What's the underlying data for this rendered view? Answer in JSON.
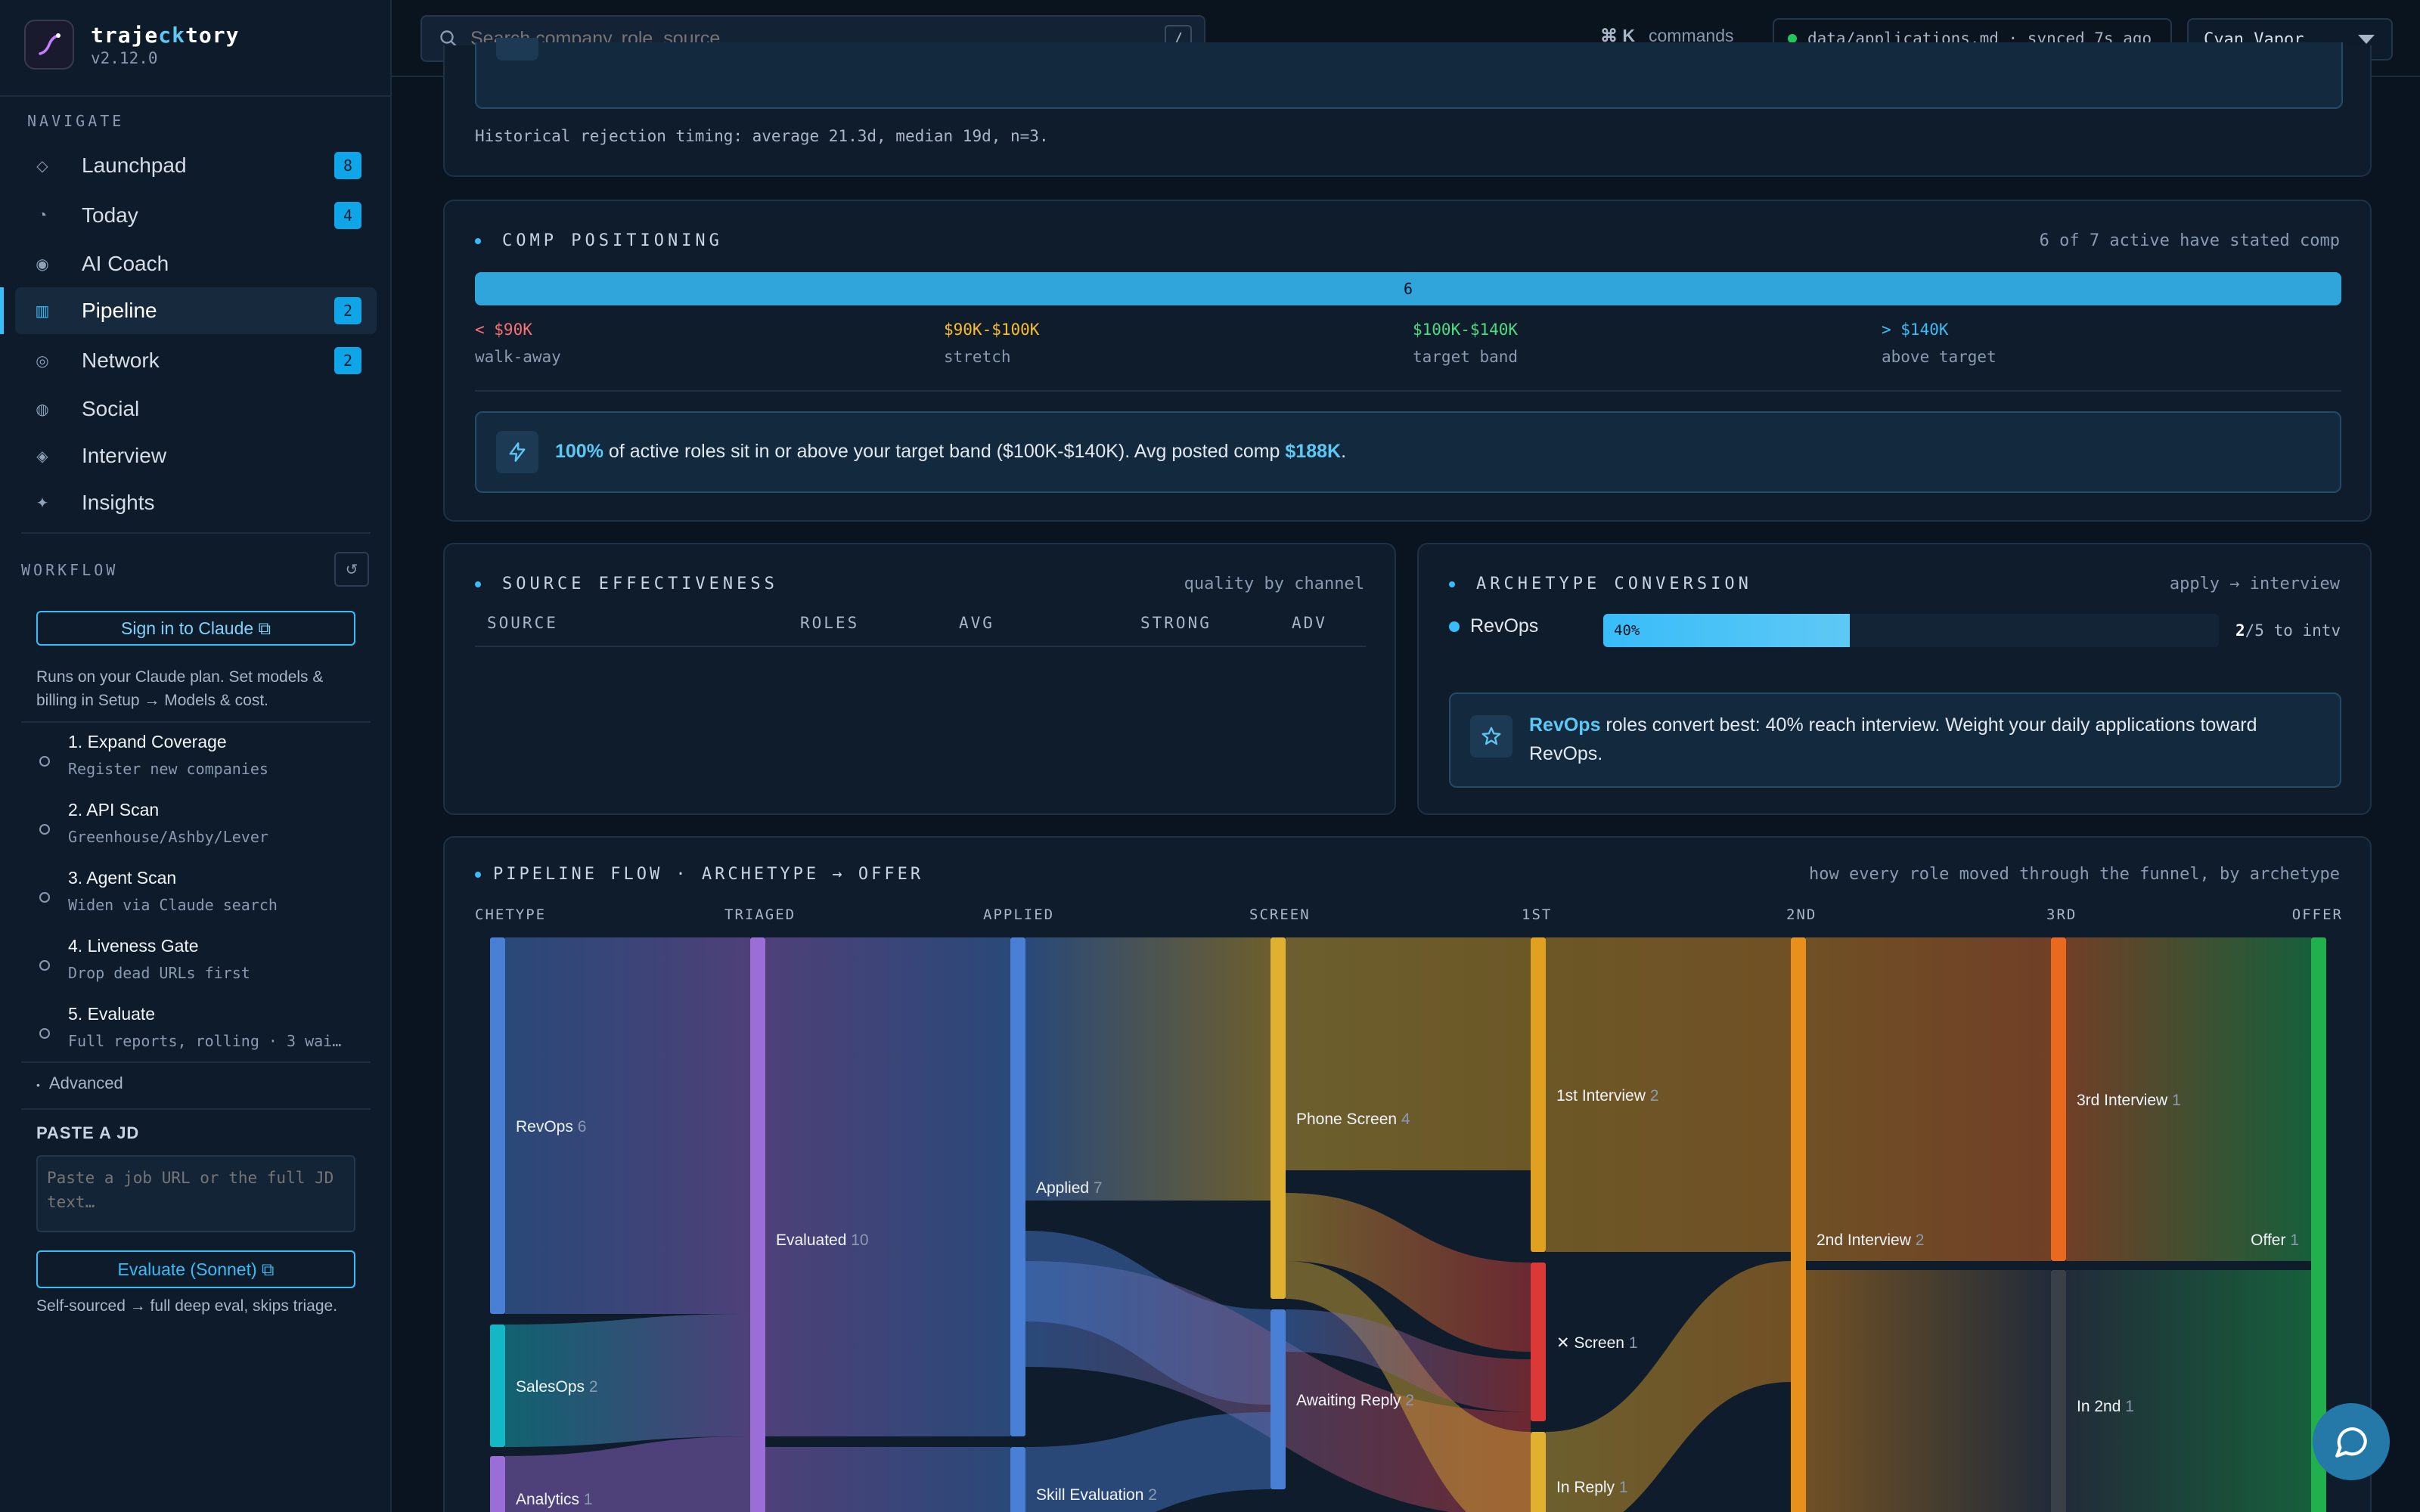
{
  "brand": {
    "name_prefix": "traje",
    "name_hl": "ck",
    "name_suffix": "tory",
    "version": "v2.12.0"
  },
  "sidebar": {
    "navigate_label": "NAVIGATE",
    "items": [
      {
        "label": "Launchpad",
        "icon": "diamond-icon",
        "badge": "8"
      },
      {
        "label": "Today",
        "icon": "clock-icon",
        "badge": "4"
      },
      {
        "label": "AI Coach",
        "icon": "target-icon",
        "badge": ""
      },
      {
        "label": "Pipeline",
        "icon": "columns-icon",
        "badge": "2",
        "active": true
      },
      {
        "label": "Network",
        "icon": "network-icon",
        "badge": "2"
      },
      {
        "label": "Social",
        "icon": "social-icon",
        "badge": ""
      },
      {
        "label": "Interview",
        "icon": "interview-icon",
        "badge": ""
      },
      {
        "label": "Insights",
        "icon": "sparkle-icon",
        "badge": ""
      }
    ],
    "workflow_label": "WORKFLOW",
    "sign_in_label": "Sign in to Claude ⧉",
    "plan_text": "Runs on your Claude plan. Set models & billing in Setup → Models & cost.",
    "steps": [
      {
        "title": "1. Expand Coverage",
        "sub": "Register new companies"
      },
      {
        "title": "2. API Scan",
        "sub": "Greenhouse/Ashby/Lever"
      },
      {
        "title": "3. Agent Scan",
        "sub": "Widen via Claude search"
      },
      {
        "title": "4. Liveness Gate",
        "sub": "Drop dead URLs first"
      },
      {
        "title": "5. Evaluate",
        "sub": "Full reports, rolling · 3 wai…"
      }
    ],
    "advanced_label": "Advanced",
    "paste_jd_label": "PASTE A JD",
    "jd_placeholder": "Paste a job URL or the full JD text…",
    "evaluate_label": "Evaluate (Sonnet) ⧉",
    "self_sourced_note": "Self-sourced → full deep eval, skips triage."
  },
  "topbar": {
    "search_placeholder": "Search company, role, source…",
    "search_kbd": "/",
    "cmd_keys": "⌘ K",
    "cmd_label": "commands",
    "sync_text": "data/applications.md · synced 7s ago",
    "theme": "Cyan Vapor"
  },
  "rejection_note": "Historical rejection timing: average 21.3d, median 19d, n=3.",
  "comp": {
    "title": "COMP POSITIONING",
    "meta": "6 of 7 active have stated comp",
    "bar_value": "6",
    "bar_fill": 1.0,
    "tiers": [
      {
        "range": "< $90K",
        "name": "walk-away",
        "color": "#f87171"
      },
      {
        "range": "$90K-$100K",
        "name": "stretch",
        "color": "#fbbf24"
      },
      {
        "range": "$100K-$140K",
        "name": "target band",
        "color": "#4ade80"
      },
      {
        "range": "> $140K",
        "name": "above target",
        "color": "#38bdf8"
      }
    ],
    "insight_pct": "100%",
    "insight_mid": " of active roles sit in or above your target band ($100K-$140K). Avg posted comp ",
    "insight_avg": "$188K",
    "insight_end": "."
  },
  "source": {
    "title": "SOURCE EFFECTIVENESS",
    "meta": "quality by channel",
    "columns": [
      "SOURCE",
      "ROLES",
      "AVG",
      "STRONG",
      "ADV"
    ]
  },
  "archetype": {
    "title": "ARCHETYPE CONVERSION",
    "meta": "apply → interview",
    "row": {
      "name": "RevOps",
      "pct": "40%",
      "fill": 0.4,
      "count": "2",
      "total": "/5 to intv"
    },
    "insight_hl": "RevOps",
    "insight_text": " roles convert best: 40% reach interview. Weight your daily applications toward RevOps."
  },
  "flow": {
    "title": "PIPELINE FLOW · ARCHETYPE → OFFER",
    "meta": "how every role moved through the funnel, by archetype",
    "columns": [
      "CHETYPE",
      "TRIAGED",
      "APPLIED",
      "SCREEN",
      "1ST",
      "2ND",
      "3RD",
      "OFFER"
    ],
    "nodes": [
      {
        "label": "RevOps",
        "count": "6",
        "color": "#4a7fd6"
      },
      {
        "label": "SalesOps",
        "count": "2",
        "color": "#14b8c4"
      },
      {
        "label": "Analytics",
        "count": "1",
        "color": "#9b6dd6"
      },
      {
        "label": "Evaluated",
        "count": "10",
        "color": "#9b6dd6"
      },
      {
        "label": "Applied",
        "count": "7",
        "color": "#4a7fd6"
      },
      {
        "label": "Skill Evaluation",
        "count": "2",
        "color": "#4a7fd6"
      },
      {
        "label": "Phone Screen",
        "count": "4",
        "color": "#e0b030"
      },
      {
        "label": "Awaiting Reply",
        "count": "2",
        "color": "#4a7fd6"
      },
      {
        "label": "1st Interview",
        "count": "2",
        "color": "#e0a020"
      },
      {
        "label": "✕ Screen",
        "count": "1",
        "color": "#dc3838"
      },
      {
        "label": "In Reply",
        "count": "1",
        "color": "#e0b030"
      },
      {
        "label": "2nd Interview",
        "count": "2",
        "color": "#e8901c"
      },
      {
        "label": "3rd Interview",
        "count": "1",
        "color": "#e86a20"
      },
      {
        "label": "In 2nd",
        "count": "1",
        "color": "#3a3f48"
      },
      {
        "label": "Offer",
        "count": "1",
        "color": "#22b04e"
      }
    ]
  },
  "colors": {
    "accent": "#38bdf8",
    "badge": "#0ea5e9",
    "bg": "#0a1420"
  }
}
